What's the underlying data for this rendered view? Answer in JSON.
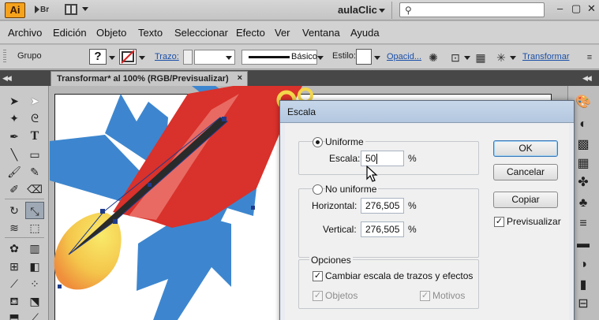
{
  "app": {
    "logo": "Ai",
    "bridge_label": "Br",
    "workspace": "aulaClic",
    "window_controls": [
      "–",
      "▢",
      "✕"
    ]
  },
  "menu": [
    "Archivo",
    "Edición",
    "Objeto",
    "Texto",
    "Seleccionar",
    "Efecto",
    "Ver",
    "Ventana",
    "Ayuda"
  ],
  "control_bar": {
    "selection_label": "Grupo",
    "stroke_link": "Trazo:",
    "brush_label": "Básico",
    "style_label": "Estilo:",
    "opacity_link": "Opacid...",
    "transform_link": "Transformar"
  },
  "document": {
    "tab_title": "Transformar* al 100% (RGB/Previsualizar)",
    "close_glyph": "×"
  },
  "dialog": {
    "title": "Escala",
    "uniform": {
      "label": "Uniforme",
      "selected": true,
      "scale_label": "Escala:",
      "scale_value": "50",
      "unit": "%"
    },
    "non_uniform": {
      "label": "No uniforme",
      "selected": false,
      "horizontal_label": "Horizontal:",
      "horizontal_value": "276,505",
      "vertical_label": "Vertical:",
      "vertical_value": "276,505",
      "unit": "%"
    },
    "options": {
      "label": "Opciones",
      "scale_strokes": {
        "label": "Cambiar escala de trazos y efectos",
        "checked": true
      },
      "objects": {
        "label": "Objetos",
        "checked": true,
        "enabled": false
      },
      "patterns": {
        "label": "Motivos",
        "checked": true,
        "enabled": false
      }
    },
    "buttons": {
      "ok": "OK",
      "cancel": "Cancelar",
      "copy": "Copiar",
      "preview": {
        "label": "Previsualizar",
        "checked": true
      }
    }
  },
  "colors": {
    "rocket_blue": "#3d86cf",
    "rocket_red": "#d9312b",
    "rocket_dark": "#2a2a2a",
    "flame_yellow": "#f4d64b",
    "flame_orange": "#ef9a3c",
    "selection": "#1f3c8c"
  }
}
